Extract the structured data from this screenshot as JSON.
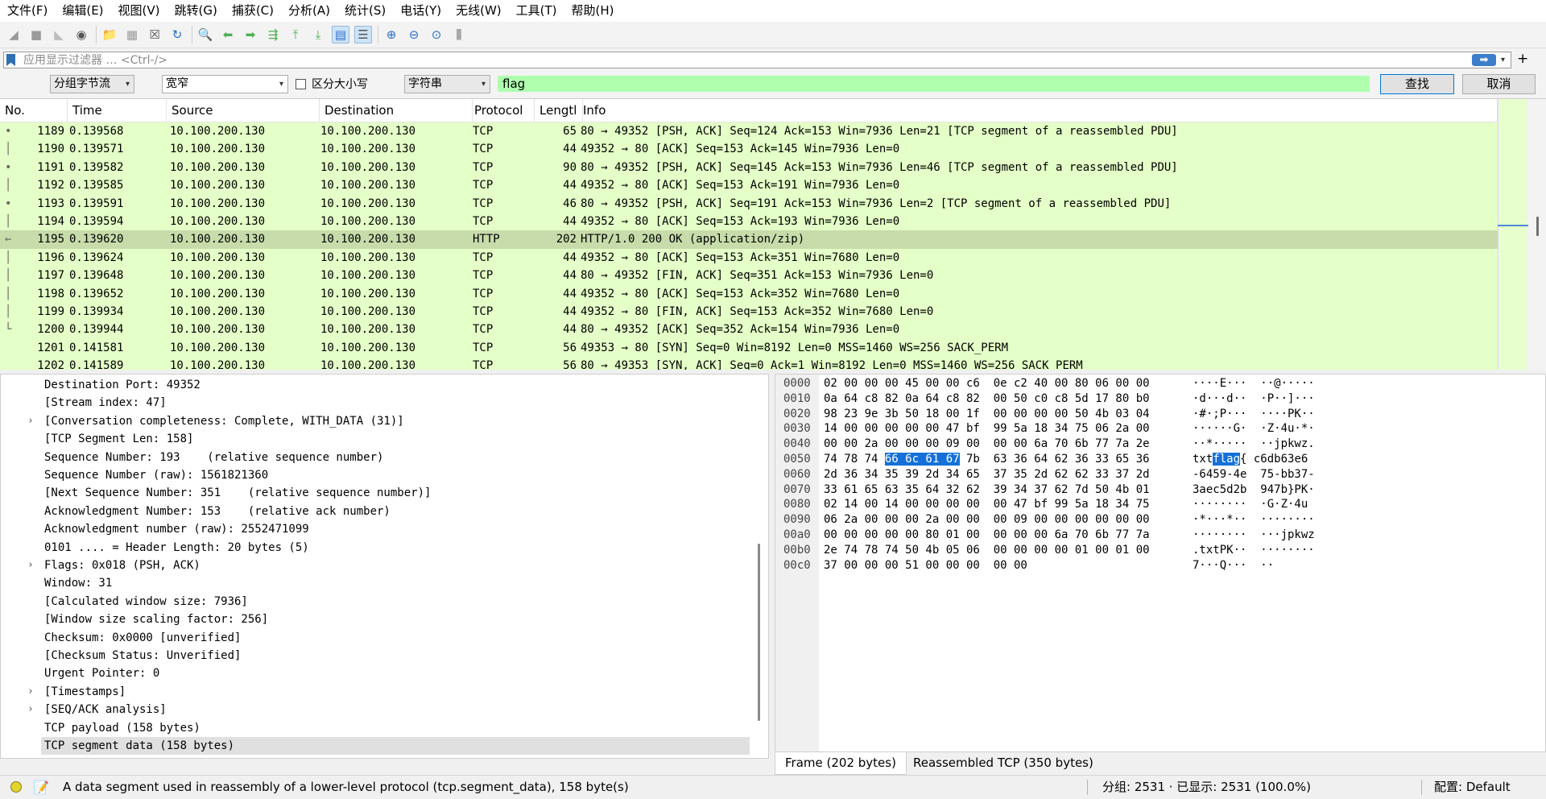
{
  "menu": [
    "文件(F)",
    "编辑(E)",
    "视图(V)",
    "跳转(G)",
    "捕获(C)",
    "分析(A)",
    "统计(S)",
    "电话(Y)",
    "无线(W)",
    "工具(T)",
    "帮助(H)"
  ],
  "toolbar": {
    "icons": [
      {
        "name": "shark-fin-start-icon",
        "glyph": "◢",
        "color": "#9a9a9a"
      },
      {
        "name": "stop-capture-icon",
        "glyph": "■",
        "color": "#9a9a9a"
      },
      {
        "name": "restart-capture-icon",
        "glyph": "◣",
        "color": "#bdbdbd"
      },
      {
        "name": "capture-options-icon",
        "glyph": "◉",
        "color": "#555555"
      },
      {
        "name": "sep"
      },
      {
        "name": "open-file-icon",
        "glyph": "📁",
        "color": "#d9a62a"
      },
      {
        "name": "save-file-icon",
        "glyph": "▦",
        "color": "#9a9a9a"
      },
      {
        "name": "close-file-icon",
        "glyph": "☒",
        "color": "#555555"
      },
      {
        "name": "reload-file-icon",
        "glyph": "↻",
        "color": "#2a6fc9"
      },
      {
        "name": "sep"
      },
      {
        "name": "find-packet-icon",
        "glyph": "🔍",
        "color": "#555555"
      },
      {
        "name": "go-back-icon",
        "glyph": "⬅",
        "color": "#4caf50"
      },
      {
        "name": "go-forward-icon",
        "glyph": "➡",
        "color": "#4caf50"
      },
      {
        "name": "go-to-packet-icon",
        "glyph": "⇶",
        "color": "#4caf50"
      },
      {
        "name": "go-first-icon",
        "glyph": "⤒",
        "color": "#4caf50"
      },
      {
        "name": "go-last-icon",
        "glyph": "⤓",
        "color": "#4caf50"
      },
      {
        "name": "auto-scroll-icon",
        "glyph": "▤",
        "color": "#2a6fc9",
        "selected": true
      },
      {
        "name": "colorize-icon",
        "glyph": "☰",
        "color": "#555555",
        "selected": true
      },
      {
        "name": "sep"
      },
      {
        "name": "zoom-in-icon",
        "glyph": "⊕",
        "color": "#2a6fc9"
      },
      {
        "name": "zoom-out-icon",
        "glyph": "⊖",
        "color": "#2a6fc9"
      },
      {
        "name": "zoom-normal-icon",
        "glyph": "⊙",
        "color": "#2a6fc9"
      },
      {
        "name": "resize-columns-icon",
        "glyph": "⫼",
        "color": "#555555"
      }
    ]
  },
  "filter": {
    "placeholder": "应用显示过滤器 … <Ctrl-/>",
    "apply_label": "➡",
    "dropdown": "▾",
    "add_label": "+"
  },
  "find": {
    "scope": "分组字节流",
    "encoding": "宽窄",
    "case_label": "区分大小写",
    "type": "字符串",
    "query": "flag",
    "find_label": "查找",
    "cancel_label": "取消"
  },
  "columns": [
    "No.",
    "Time",
    "Source",
    "Destination",
    "Protocol",
    "Lengtl",
    "Info"
  ],
  "packets": [
    {
      "no": "1189",
      "time": "0.139568",
      "src": "10.100.200.130",
      "dst": "10.100.200.130",
      "proto": "TCP",
      "len": "65",
      "info": "80 → 49352 [PSH, ACK] Seq=124 Ack=153 Win=7936 Len=21 [TCP segment of a reassembled PDU]",
      "mark": "•"
    },
    {
      "no": "1190",
      "time": "0.139571",
      "src": "10.100.200.130",
      "dst": "10.100.200.130",
      "proto": "TCP",
      "len": "44",
      "info": "49352 → 80 [ACK] Seq=153 Ack=145 Win=7936 Len=0",
      "mark": "│"
    },
    {
      "no": "1191",
      "time": "0.139582",
      "src": "10.100.200.130",
      "dst": "10.100.200.130",
      "proto": "TCP",
      "len": "90",
      "info": "80 → 49352 [PSH, ACK] Seq=145 Ack=153 Win=7936 Len=46 [TCP segment of a reassembled PDU]",
      "mark": "•"
    },
    {
      "no": "1192",
      "time": "0.139585",
      "src": "10.100.200.130",
      "dst": "10.100.200.130",
      "proto": "TCP",
      "len": "44",
      "info": "49352 → 80 [ACK] Seq=153 Ack=191 Win=7936 Len=0",
      "mark": "│"
    },
    {
      "no": "1193",
      "time": "0.139591",
      "src": "10.100.200.130",
      "dst": "10.100.200.130",
      "proto": "TCP",
      "len": "46",
      "info": "80 → 49352 [PSH, ACK] Seq=191 Ack=153 Win=7936 Len=2 [TCP segment of a reassembled PDU]",
      "mark": "•"
    },
    {
      "no": "1194",
      "time": "0.139594",
      "src": "10.100.200.130",
      "dst": "10.100.200.130",
      "proto": "TCP",
      "len": "44",
      "info": "49352 → 80 [ACK] Seq=153 Ack=193 Win=7936 Len=0",
      "mark": "│"
    },
    {
      "no": "1195",
      "time": "0.139620",
      "src": "10.100.200.130",
      "dst": "10.100.200.130",
      "proto": "HTTP",
      "len": "202",
      "info": "HTTP/1.0 200 OK  (application/zip)",
      "mark": "←",
      "selected": true
    },
    {
      "no": "1196",
      "time": "0.139624",
      "src": "10.100.200.130",
      "dst": "10.100.200.130",
      "proto": "TCP",
      "len": "44",
      "info": "49352 → 80 [ACK] Seq=153 Ack=351 Win=7680 Len=0",
      "mark": "│"
    },
    {
      "no": "1197",
      "time": "0.139648",
      "src": "10.100.200.130",
      "dst": "10.100.200.130",
      "proto": "TCP",
      "len": "44",
      "info": "80 → 49352 [FIN, ACK] Seq=351 Ack=153 Win=7936 Len=0",
      "mark": "│"
    },
    {
      "no": "1198",
      "time": "0.139652",
      "src": "10.100.200.130",
      "dst": "10.100.200.130",
      "proto": "TCP",
      "len": "44",
      "info": "49352 → 80 [ACK] Seq=153 Ack=352 Win=7680 Len=0",
      "mark": "│"
    },
    {
      "no": "1199",
      "time": "0.139934",
      "src": "10.100.200.130",
      "dst": "10.100.200.130",
      "proto": "TCP",
      "len": "44",
      "info": "49352 → 80 [FIN, ACK] Seq=153 Ack=352 Win=7680 Len=0",
      "mark": "│"
    },
    {
      "no": "1200",
      "time": "0.139944",
      "src": "10.100.200.130",
      "dst": "10.100.200.130",
      "proto": "TCP",
      "len": "44",
      "info": "80 → 49352 [ACK] Seq=352 Ack=154 Win=7936 Len=0",
      "mark": "└"
    },
    {
      "no": "1201",
      "time": "0.141581",
      "src": "10.100.200.130",
      "dst": "10.100.200.130",
      "proto": "TCP",
      "len": "56",
      "info": "49353 → 80 [SYN] Seq=0 Win=8192 Len=0 MSS=1460 WS=256 SACK_PERM",
      "mark": ""
    },
    {
      "no": "1202",
      "time": "0.141589",
      "src": "10.100.200.130",
      "dst": "10.100.200.130",
      "proto": "TCP",
      "len": "56",
      "info": "80 → 49353 [SYN, ACK] Seq=0 Ack=1 Win=8192 Len=0 MSS=1460 WS=256 SACK_PERM",
      "mark": ""
    }
  ],
  "details": [
    {
      "text": "Destination Port: 49352",
      "exp": ""
    },
    {
      "text": "[Stream index: 47]",
      "exp": ""
    },
    {
      "text": "[Conversation completeness: Complete, WITH_DATA (31)]",
      "exp": "›"
    },
    {
      "text": "[TCP Segment Len: 158]",
      "exp": ""
    },
    {
      "text": "Sequence Number: 193    (relative sequence number)",
      "exp": ""
    },
    {
      "text": "Sequence Number (raw): 1561821360",
      "exp": ""
    },
    {
      "text": "[Next Sequence Number: 351    (relative sequence number)]",
      "exp": ""
    },
    {
      "text": "Acknowledgment Number: 153    (relative ack number)",
      "exp": ""
    },
    {
      "text": "Acknowledgment number (raw): 2552471099",
      "exp": ""
    },
    {
      "text": "0101 .... = Header Length: 20 bytes (5)",
      "exp": ""
    },
    {
      "text": "Flags: 0x018 (PSH, ACK)",
      "exp": "›"
    },
    {
      "text": "Window: 31",
      "exp": ""
    },
    {
      "text": "[Calculated window size: 7936]",
      "exp": ""
    },
    {
      "text": "[Window size scaling factor: 256]",
      "exp": ""
    },
    {
      "text": "Checksum: 0x0000 [unverified]",
      "exp": ""
    },
    {
      "text": "[Checksum Status: Unverified]",
      "exp": ""
    },
    {
      "text": "Urgent Pointer: 0",
      "exp": ""
    },
    {
      "text": "[Timestamps]",
      "exp": "›"
    },
    {
      "text": "[SEQ/ACK analysis]",
      "exp": "›"
    },
    {
      "text": "TCP payload (158 bytes)",
      "exp": ""
    },
    {
      "text": "TCP segment data (158 bytes)",
      "exp": "",
      "selected": true
    }
  ],
  "bytes": [
    {
      "off": "0000",
      "pre": "02 00 00 00 45 00 00 c6  0e c2 40 00 80 06 00 00",
      "hl": "",
      "post": "",
      "apre": "····E···  ··@·····",
      "ahl": "",
      "apost": ""
    },
    {
      "off": "0010",
      "pre": "0a 64 c8 82 0a 64 c8 82  00 50 c0 c8 5d 17 80 b0",
      "hl": "",
      "post": "",
      "apre": "·d···d··  ·P··]···",
      "ahl": "",
      "apost": ""
    },
    {
      "off": "0020",
      "pre": "98 23 9e 3b 50 18 00 1f  00 00 00 00 50 4b 03 04",
      "hl": "",
      "post": "",
      "apre": "·#·;P···  ····PK··",
      "ahl": "",
      "apost": ""
    },
    {
      "off": "0030",
      "pre": "14 00 00 00 00 00 47 bf  99 5a 18 34 75 06 2a 00",
      "hl": "",
      "post": "",
      "apre": "······G·  ·Z·4u·*·",
      "ahl": "",
      "apost": ""
    },
    {
      "off": "0040",
      "pre": "00 00 2a 00 00 00 09 00  00 00 6a 70 6b 77 7a 2e",
      "hl": "",
      "post": "",
      "apre": "··*·····  ··jpkwz.",
      "ahl": "",
      "apost": ""
    },
    {
      "off": "0050",
      "pre": "74 78 74 ",
      "hl": "66 6c 61 67",
      "post": " 7b  63 36 64 62 36 33 65 36",
      "apre": "txt",
      "ahl": "flag",
      "apost": "{ c6db63e6"
    },
    {
      "off": "0060",
      "pre": "2d 36 34 35 39 2d 34 65  37 35 2d 62 62 33 37 2d",
      "hl": "",
      "post": "",
      "apre": "-6459-4e  75-bb37-",
      "ahl": "",
      "apost": ""
    },
    {
      "off": "0070",
      "pre": "33 61 65 63 35 64 32 62  39 34 37 62 7d 50 4b 01",
      "hl": "",
      "post": "",
      "apre": "3aec5d2b  947b}PK·",
      "ahl": "",
      "apost": ""
    },
    {
      "off": "0080",
      "pre": "02 14 00 14 00 00 00 00  00 47 bf 99 5a 18 34 75",
      "hl": "",
      "post": "",
      "apre": "········  ·G·Z·4u",
      "ahl": "",
      "apost": ""
    },
    {
      "off": "0090",
      "pre": "06 2a 00 00 00 2a 00 00  00 09 00 00 00 00 00 00",
      "hl": "",
      "post": "",
      "apre": "·*···*··  ········",
      "ahl": "",
      "apost": ""
    },
    {
      "off": "00a0",
      "pre": "00 00 00 00 00 80 01 00  00 00 00 6a 70 6b 77 7a",
      "hl": "",
      "post": "",
      "apre": "········  ···jpkwz",
      "ahl": "",
      "apost": ""
    },
    {
      "off": "00b0",
      "pre": "2e 74 78 74 50 4b 05 06  00 00 00 00 01 00 01 00",
      "hl": "",
      "post": "",
      "apre": ".txtPK··  ········",
      "ahl": "",
      "apost": ""
    },
    {
      "off": "00c0",
      "pre": "37 00 00 00 51 00 00 00  00 00",
      "hl": "",
      "post": "",
      "apre": "7···Q···  ··",
      "ahl": "",
      "apost": ""
    }
  ],
  "byte_tabs": [
    "Frame (202 bytes)",
    "Reassembled TCP (350 bytes)"
  ],
  "status": {
    "message": "A data segment used in reassembly of a lower-level protocol (tcp.segment_data), 158 byte(s)",
    "counts": "分组: 2531 · 已显示: 2531 (100.0%)",
    "profile": "配置: Default",
    "edit_icon": "📝"
  },
  "colors": {
    "row_bg": "#e4ffc7",
    "row_selected": "#c7dcaa",
    "find_bg": "#afffaf",
    "byte_highlight": "#1470d8"
  }
}
